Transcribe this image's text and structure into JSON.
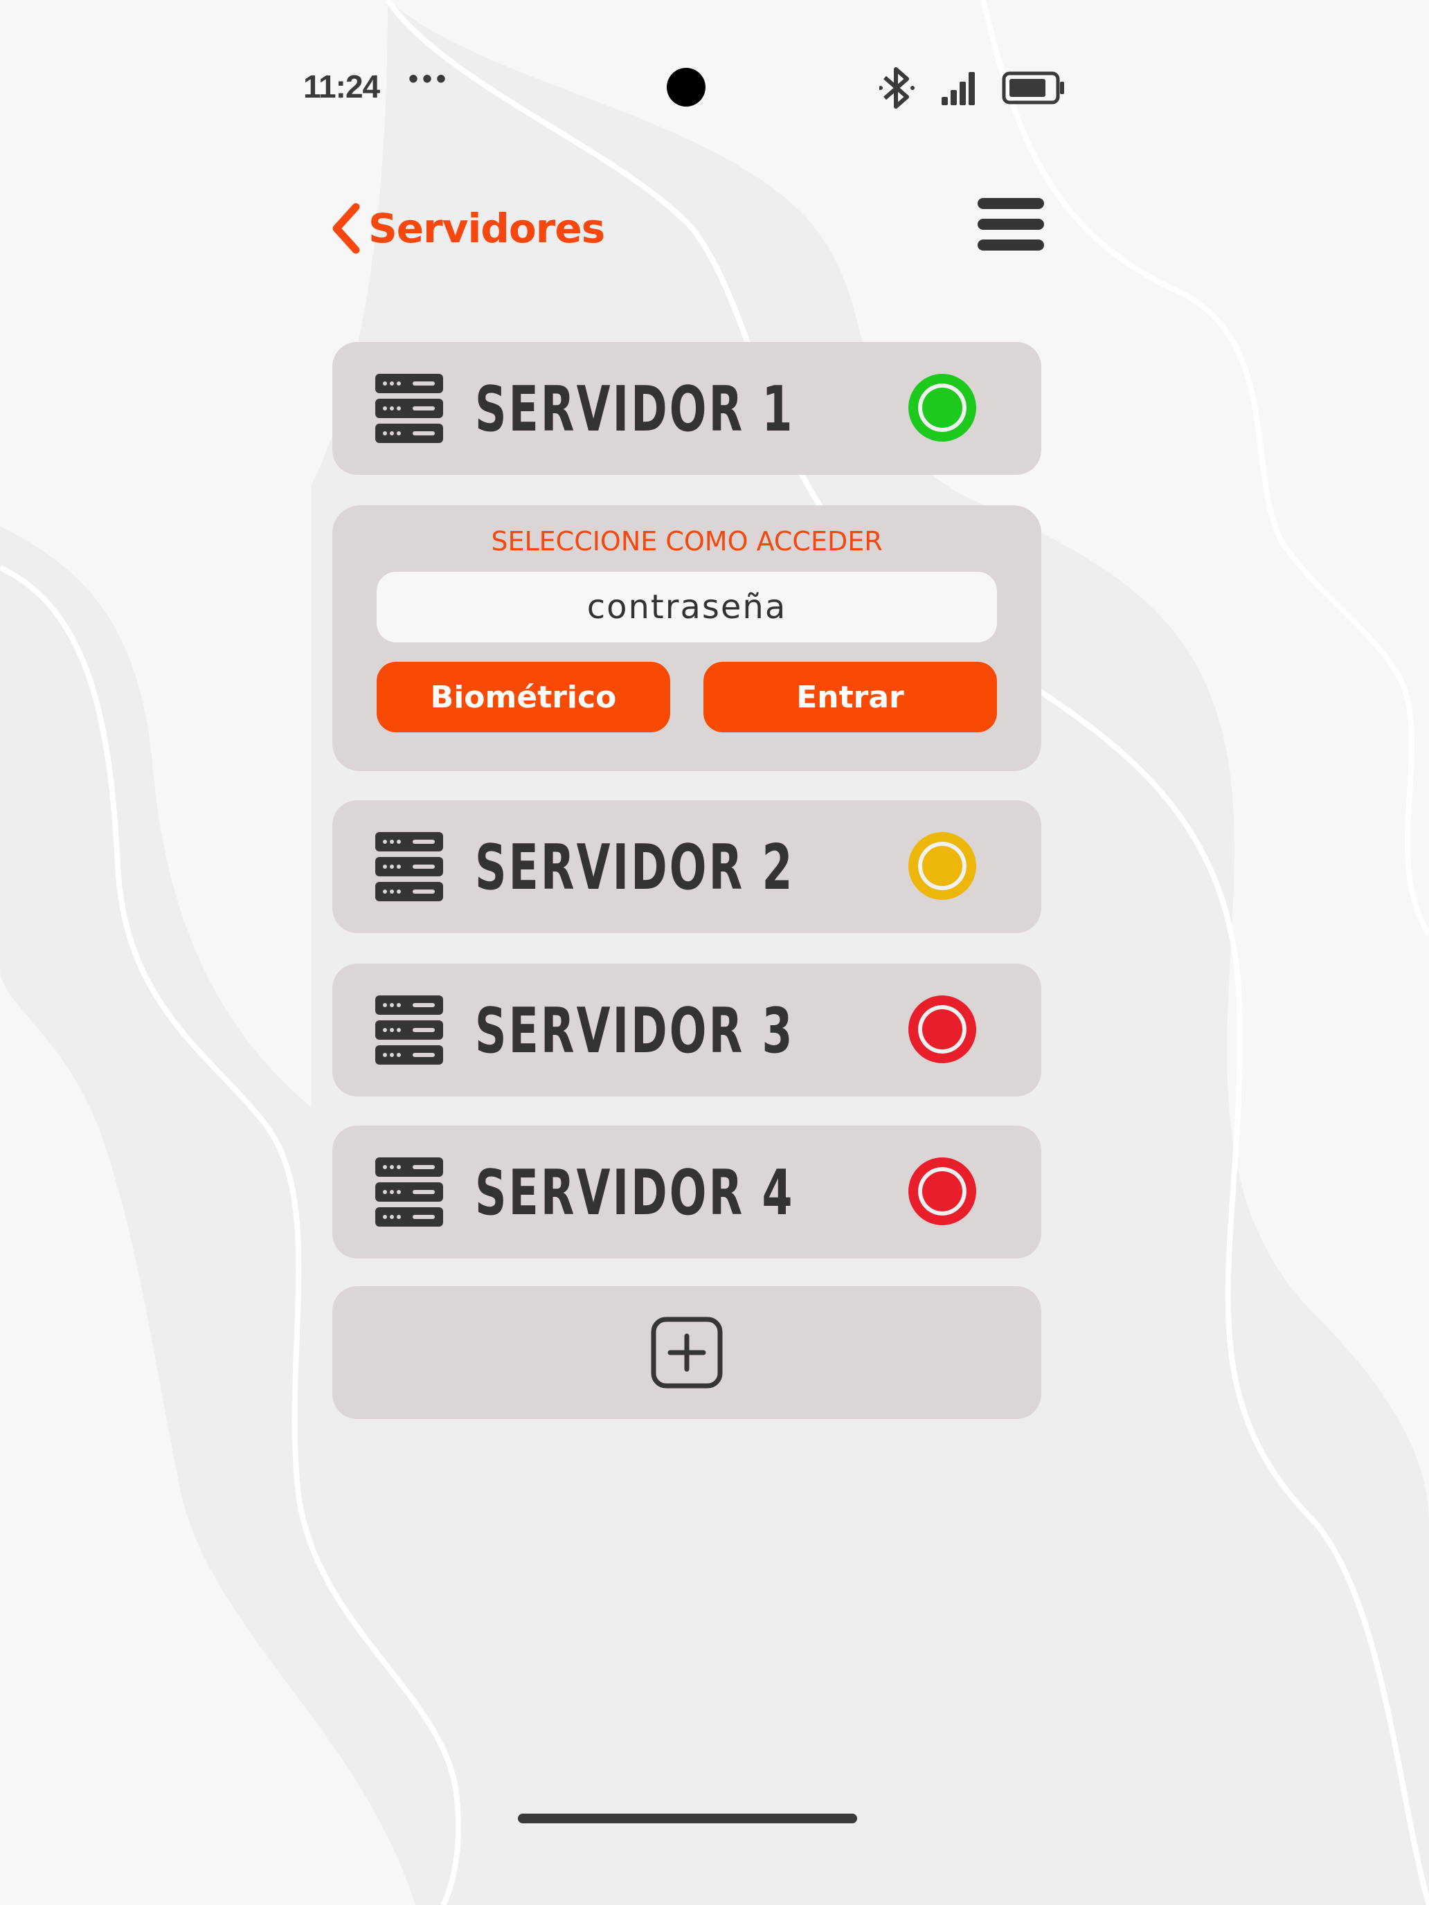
{
  "status_bar": {
    "time": "11:24",
    "dots": "•••",
    "icons": [
      "bluetooth-icon",
      "signal-icon",
      "battery-icon"
    ]
  },
  "header": {
    "back_label": "Servidores",
    "menu_icon": "hamburger-menu-icon"
  },
  "servers": [
    {
      "name": "SERVIDOR 1",
      "status": "online",
      "color": "#1ec91e"
    },
    {
      "name": "SERVIDOR 2",
      "status": "warning",
      "color": "#ecb60a"
    },
    {
      "name": "SERVIDOR 3",
      "status": "offline",
      "color": "#e81f2b"
    },
    {
      "name": "SERVIDOR 4",
      "status": "offline",
      "color": "#e81f2b"
    }
  ],
  "access_panel": {
    "title": "SELECCIONE COMO ACCEDER",
    "password_placeholder": "contraseña",
    "biometric_label": "Biométrico",
    "enter_label": "Entrar"
  },
  "colors": {
    "accent": "#f74a05",
    "card": "#dbd6d5",
    "text_dark": "#333333"
  }
}
